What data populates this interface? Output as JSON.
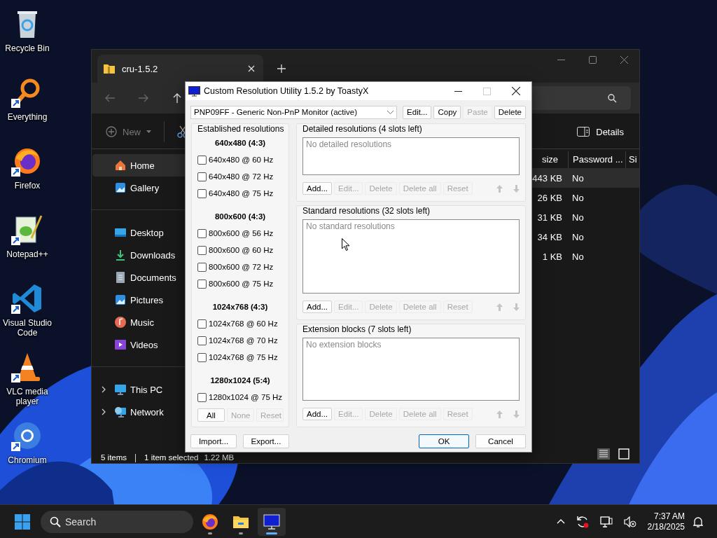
{
  "desktop_icons": [
    {
      "label": "Recycle Bin",
      "shortcut": false
    },
    {
      "label": "Everything",
      "shortcut": true
    },
    {
      "label": "Firefox",
      "shortcut": true
    },
    {
      "label": "Notepad++",
      "shortcut": true
    },
    {
      "label": "Visual Studio Code",
      "shortcut": true
    },
    {
      "label": "VLC media player",
      "shortcut": true
    },
    {
      "label": "Chromium",
      "shortcut": true
    }
  ],
  "explorer": {
    "tab_title": "cru-1.5.2",
    "nav_buttons": [
      {
        "disabled": true
      },
      {
        "disabled": true
      },
      {
        "disabled": false
      }
    ],
    "toolbar": {
      "new": "New",
      "details": "Details"
    },
    "sidebar": [
      {
        "items": [
          {
            "label": "Home",
            "selected": true
          },
          {
            "label": "Gallery",
            "selected": false
          }
        ]
      },
      {
        "items": [
          {
            "label": "Desktop",
            "selected": false
          },
          {
            "label": "Downloads",
            "selected": false
          },
          {
            "label": "Documents",
            "selected": false
          },
          {
            "label": "Pictures",
            "selected": false
          },
          {
            "label": "Music",
            "selected": false
          },
          {
            "label": "Videos",
            "selected": false
          }
        ]
      },
      {
        "items": [
          {
            "label": "This PC",
            "selected": false,
            "expanded": false
          },
          {
            "label": "Network",
            "selected": false,
            "expanded": false
          }
        ]
      }
    ],
    "columns": [
      "size",
      "Password ...",
      "Si"
    ],
    "rows": [
      {
        "size": "443 KB",
        "password": "No",
        "selected": true
      },
      {
        "size": "26 KB",
        "password": "No",
        "selected": false
      },
      {
        "size": "31 KB",
        "password": "No",
        "selected": false
      },
      {
        "size": "34 KB",
        "password": "No",
        "selected": false
      },
      {
        "size": "1 KB",
        "password": "No",
        "selected": false
      }
    ],
    "status": {
      "items": "5 items",
      "selection": "1 item selected",
      "size": "1.22 MB"
    }
  },
  "dialog": {
    "title": "Custom Resolution Utility 1.5.2 by ToastyX",
    "monitor": "PNP09FF - Generic Non-PnP Monitor (active)",
    "monitor_buttons": [
      {
        "label": "Edit...",
        "disabled": false
      },
      {
        "label": "Copy",
        "disabled": false
      },
      {
        "label": "Paste",
        "disabled": true
      },
      {
        "label": "Delete",
        "disabled": false
      }
    ],
    "established": {
      "title": "Established resolutions",
      "groups": [
        {
          "heading": "640x480 (4:3)",
          "items": [
            {
              "label": "640x480 @ 60 Hz",
              "checked": false
            },
            {
              "label": "640x480 @ 72 Hz",
              "checked": false
            },
            {
              "label": "640x480 @ 75 Hz",
              "checked": false
            }
          ]
        },
        {
          "heading": "800x600 (4:3)",
          "items": [
            {
              "label": "800x600 @ 56 Hz",
              "checked": false
            },
            {
              "label": "800x600 @ 60 Hz",
              "checked": false
            },
            {
              "label": "800x600 @ 72 Hz",
              "checked": false
            },
            {
              "label": "800x600 @ 75 Hz",
              "checked": false
            }
          ]
        },
        {
          "heading": "1024x768 (4:3)",
          "items": [
            {
              "label": "1024x768 @ 60 Hz",
              "checked": false
            },
            {
              "label": "1024x768 @ 70 Hz",
              "checked": false
            },
            {
              "label": "1024x768 @ 75 Hz",
              "checked": false
            }
          ]
        },
        {
          "heading": "1280x1024 (5:4)",
          "items": [
            {
              "label": "1280x1024 @ 75 Hz",
              "checked": false
            }
          ]
        }
      ],
      "buttons": [
        {
          "label": "All",
          "disabled": false
        },
        {
          "label": "None",
          "disabled": true
        },
        {
          "label": "Reset",
          "disabled": true
        }
      ]
    },
    "sections": [
      {
        "title": "Detailed resolutions (4 slots left)",
        "empty": "No detailed resolutions",
        "buttons": [
          {
            "label": "Add...",
            "disabled": false
          },
          {
            "label": "Edit...",
            "disabled": true
          },
          {
            "label": "Delete",
            "disabled": true
          },
          {
            "label": "Delete all",
            "disabled": true
          },
          {
            "label": "Reset",
            "disabled": true
          }
        ],
        "move_buttons": [
          {
            "disabled": true
          },
          {
            "disabled": true
          }
        ]
      },
      {
        "title": "Standard resolutions (32 slots left)",
        "empty": "No standard resolutions",
        "buttons": [
          {
            "label": "Add...",
            "disabled": false
          },
          {
            "label": "Edit...",
            "disabled": true
          },
          {
            "label": "Delete",
            "disabled": true
          },
          {
            "label": "Delete all",
            "disabled": true
          },
          {
            "label": "Reset",
            "disabled": true
          }
        ],
        "move_buttons": [
          {
            "disabled": true
          },
          {
            "disabled": true
          }
        ]
      },
      {
        "title": "Extension blocks (7 slots left)",
        "empty": "No extension blocks",
        "buttons": [
          {
            "label": "Add...",
            "disabled": false
          },
          {
            "label": "Edit...",
            "disabled": true
          },
          {
            "label": "Delete",
            "disabled": true
          },
          {
            "label": "Delete all",
            "disabled": true
          },
          {
            "label": "Reset",
            "disabled": true
          }
        ],
        "move_buttons": [
          {
            "disabled": true
          },
          {
            "disabled": true
          }
        ]
      }
    ],
    "file_buttons": [
      {
        "label": "Import..."
      },
      {
        "label": "Export..."
      }
    ],
    "confirm_buttons": [
      {
        "label": "OK",
        "default": true
      },
      {
        "label": "Cancel",
        "default": false
      }
    ]
  },
  "taskbar": {
    "search_placeholder": "Search",
    "apps": [
      {
        "selected": false
      },
      {
        "selected": false
      },
      {
        "selected": true
      }
    ],
    "time": "7:37 AM",
    "date": "2/18/2025"
  }
}
